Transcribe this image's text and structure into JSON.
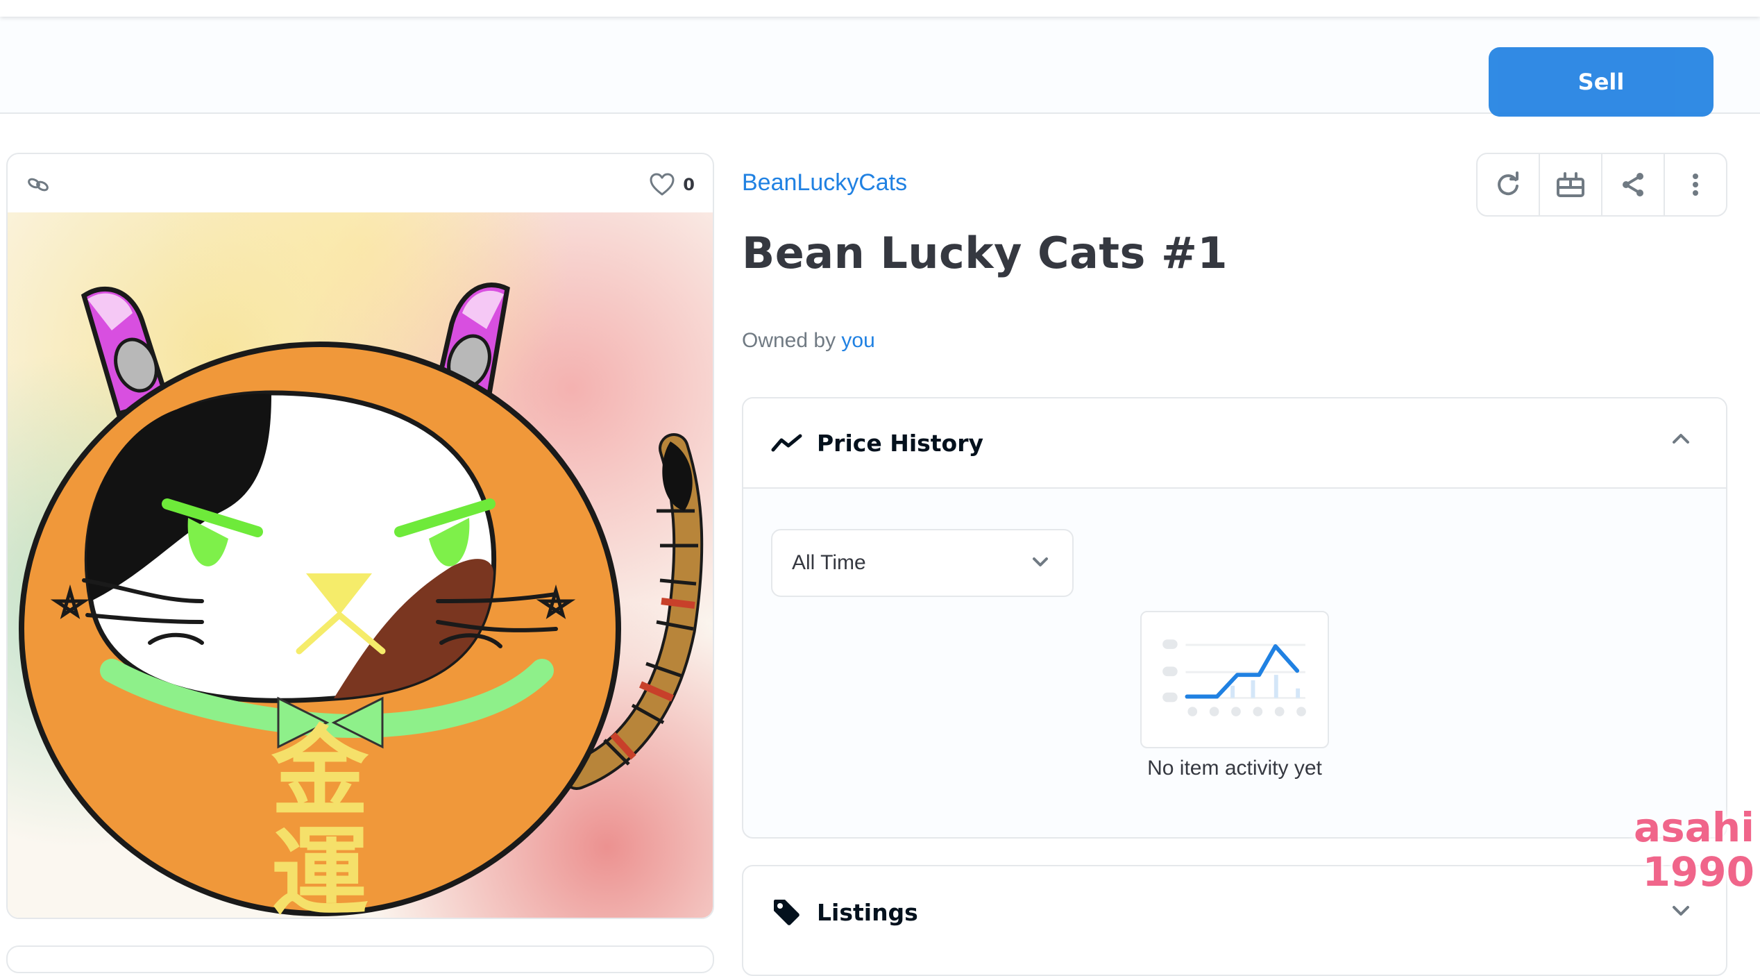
{
  "header": {
    "sell_label": "Sell"
  },
  "image_card": {
    "favorites_count": "0"
  },
  "item": {
    "collection": "BeanLuckyCats",
    "title": "Bean Lucky Cats #1",
    "owned_by_label": "Owned by",
    "owner": "you"
  },
  "toolbar": {
    "icons": [
      "refresh-icon",
      "gift-icon",
      "share-icon",
      "more-icon"
    ]
  },
  "price_history": {
    "title": "Price History",
    "range_value": "All Time",
    "empty_text": "No item activity yet"
  },
  "listings": {
    "title": "Listings"
  },
  "art": {
    "kanji_1": "金",
    "kanji_2": "運"
  },
  "watermark": {
    "line1": "asahi",
    "line2": "1990"
  },
  "colors": {
    "accent": "#2081e2",
    "border": "#e5e8eb",
    "watermark": "#f0658a"
  }
}
